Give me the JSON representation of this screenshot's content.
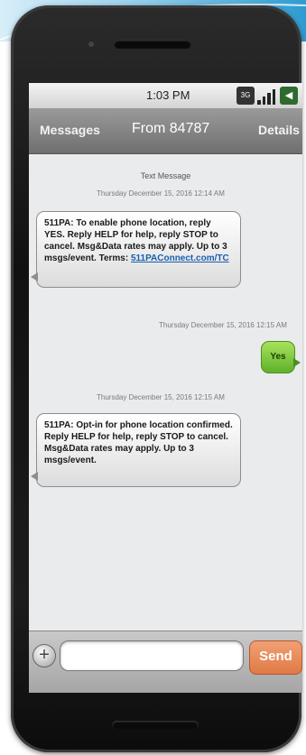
{
  "status_bar": {
    "time": "1:03 PM",
    "network": "3G",
    "network_sub": "↑↓"
  },
  "title_bar": {
    "back_label": "Messages",
    "title": "From 84787",
    "details_label": "Details"
  },
  "conversation": {
    "header": "Text Message",
    "messages": [
      {
        "direction": "incoming",
        "timestamp": "Thursday December 15, 2016 12:14 AM",
        "text": "511PA: To enable phone location, reply YES. Reply HELP for help, reply STOP to cancel. Msg&Data rates may apply. Up to 3 msgs/event. Terms: ",
        "link": "511PAConnect.com/TC"
      },
      {
        "direction": "outgoing",
        "timestamp": "Thursday December 15, 2016 12:15 AM",
        "text": "Yes"
      },
      {
        "direction": "incoming",
        "timestamp": "Thursday December 15, 2016 12:15 AM",
        "text": "511PA: Opt-in for phone location confirmed. Reply HELP for help, reply STOP to cancel. Msg&Data rates may apply. Up to 3 msgs/event."
      }
    ]
  },
  "composer": {
    "add_icon": "plus-icon",
    "input_value": "",
    "input_placeholder": "",
    "send_label": "Send"
  },
  "colors": {
    "outgoing_bubble": "#7cc63c",
    "send_button": "#e88a57",
    "titlebar": "#8a8a8a"
  }
}
